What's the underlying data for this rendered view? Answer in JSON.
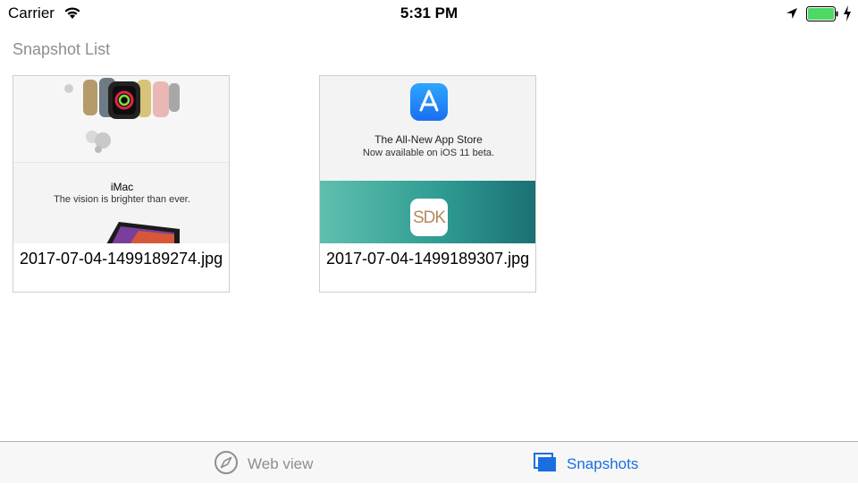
{
  "status_bar": {
    "carrier": "Carrier",
    "time": "5:31 PM",
    "icons": [
      "wifi-icon",
      "location-icon",
      "battery-icon",
      "charging-icon"
    ],
    "battery_color": "#4cd964"
  },
  "page": {
    "title": "Snapshot List"
  },
  "snapshots": [
    {
      "filename": "2017-07-04-1499189274.jpg",
      "thumbnail": {
        "headline": "iMac",
        "subline": "The vision is brighter than ever."
      }
    },
    {
      "filename": "2017-07-04-1499189307.jpg",
      "thumbnail": {
        "headline": "The All-New App Store",
        "subline": "Now available on iOS 11 beta.",
        "badge_text": "SDK"
      }
    }
  ],
  "tab_bar": {
    "tabs": [
      {
        "label": "Web view",
        "icon": "compass-icon",
        "selected": false
      },
      {
        "label": "Snapshots",
        "icon": "snapshots-icon",
        "selected": true
      }
    ],
    "active_color": "#1a6fe0",
    "inactive_color": "#8e8e93"
  }
}
